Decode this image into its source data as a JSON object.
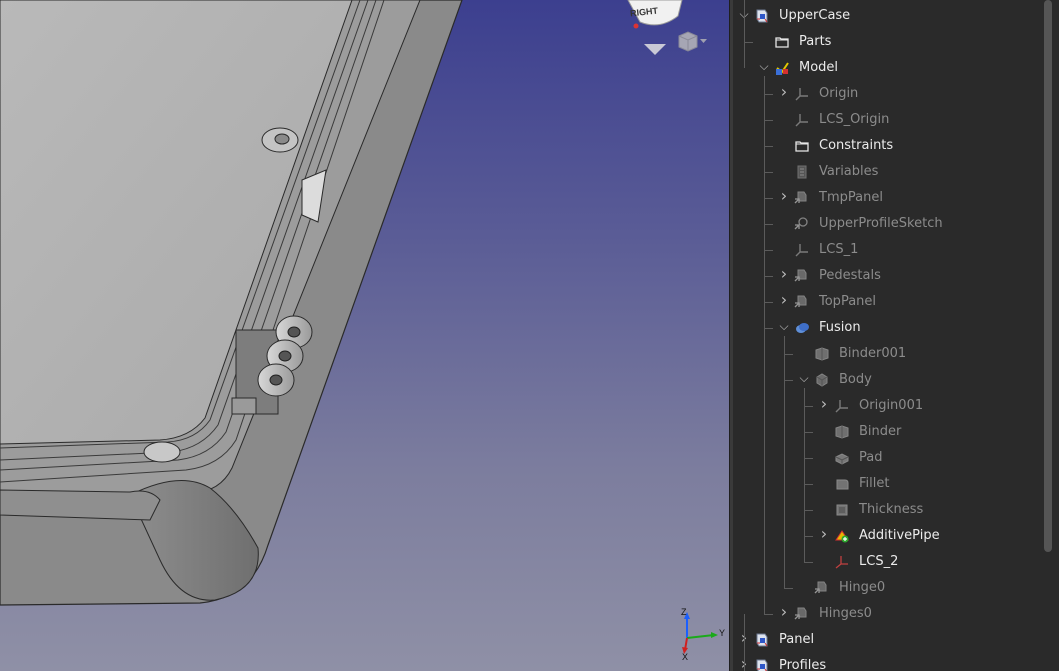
{
  "navigation_cube": {
    "face_label": "RIGHT",
    "menu_icon": "cube-menu-icon",
    "arrow_icon": "triangle-down-icon"
  },
  "axis_triad": {
    "z": "Z",
    "y": "Y",
    "x": "X"
  },
  "tree": {
    "items": [
      {
        "id": "uppercase",
        "label": "UpperCase",
        "depth": 0,
        "expander": "open",
        "enabled": true,
        "icon": "part-icon"
      },
      {
        "id": "parts",
        "label": "Parts",
        "depth": 1,
        "expander": "none",
        "enabled": true,
        "icon": "folder-icon"
      },
      {
        "id": "model",
        "label": "Model",
        "depth": 1,
        "expander": "open",
        "enabled": true,
        "icon": "model-icon"
      },
      {
        "id": "origin",
        "label": "Origin",
        "depth": 2,
        "expander": "closed",
        "enabled": false,
        "icon": "axes-icon"
      },
      {
        "id": "lcs-origin",
        "label": "LCS_Origin",
        "depth": 2,
        "expander": "none",
        "enabled": false,
        "icon": "axes-icon"
      },
      {
        "id": "constraints",
        "label": "Constraints",
        "depth": 2,
        "expander": "none",
        "enabled": true,
        "icon": "folder-icon"
      },
      {
        "id": "variables",
        "label": "Variables",
        "depth": 2,
        "expander": "none",
        "enabled": false,
        "icon": "variables-icon"
      },
      {
        "id": "tmppanel",
        "label": "TmpPanel",
        "depth": 2,
        "expander": "closed",
        "enabled": false,
        "icon": "link-icon"
      },
      {
        "id": "upperprofilesketch",
        "label": "UpperProfileSketch",
        "depth": 2,
        "expander": "none",
        "enabled": false,
        "icon": "sketch-link-icon"
      },
      {
        "id": "lcs-1",
        "label": "LCS_1",
        "depth": 2,
        "expander": "none",
        "enabled": false,
        "icon": "axes-icon"
      },
      {
        "id": "pedestals",
        "label": "Pedestals",
        "depth": 2,
        "expander": "closed",
        "enabled": false,
        "icon": "link-icon"
      },
      {
        "id": "toppanel",
        "label": "TopPanel",
        "depth": 2,
        "expander": "closed",
        "enabled": false,
        "icon": "link-icon"
      },
      {
        "id": "fusion",
        "label": "Fusion",
        "depth": 2,
        "expander": "open",
        "enabled": true,
        "icon": "fusion-icon"
      },
      {
        "id": "binder001",
        "label": "Binder001",
        "depth": 3,
        "expander": "none",
        "enabled": false,
        "icon": "binder-icon"
      },
      {
        "id": "body",
        "label": "Body",
        "depth": 3,
        "expander": "open",
        "enabled": false,
        "icon": "body-icon"
      },
      {
        "id": "origin001",
        "label": "Origin001",
        "depth": 4,
        "expander": "closed",
        "enabled": false,
        "icon": "axes-icon"
      },
      {
        "id": "binder",
        "label": "Binder",
        "depth": 4,
        "expander": "none",
        "enabled": false,
        "icon": "binder-icon"
      },
      {
        "id": "pad",
        "label": "Pad",
        "depth": 4,
        "expander": "none",
        "enabled": false,
        "icon": "pad-icon"
      },
      {
        "id": "fillet",
        "label": "Fillet",
        "depth": 4,
        "expander": "none",
        "enabled": false,
        "icon": "fillet-icon"
      },
      {
        "id": "thickness",
        "label": "Thickness",
        "depth": 4,
        "expander": "none",
        "enabled": false,
        "icon": "thickness-icon"
      },
      {
        "id": "additivepipe",
        "label": "AdditivePipe",
        "depth": 4,
        "expander": "closed",
        "enabled": true,
        "icon": "additive-pipe-icon"
      },
      {
        "id": "lcs-2",
        "label": "LCS_2",
        "depth": 4,
        "expander": "none",
        "enabled": true,
        "icon": "lcs-red-icon"
      },
      {
        "id": "hinge0",
        "label": "Hinge0",
        "depth": 3,
        "expander": "none",
        "enabled": false,
        "icon": "link-icon"
      },
      {
        "id": "hinges0",
        "label": "Hinges0",
        "depth": 2,
        "expander": "closed",
        "enabled": false,
        "icon": "link-icon"
      },
      {
        "id": "panel",
        "label": "Panel",
        "depth": 0,
        "expander": "closed",
        "enabled": true,
        "icon": "part-icon"
      },
      {
        "id": "profiles",
        "label": "Profiles",
        "depth": 0,
        "expander": "closed",
        "enabled": true,
        "icon": "part-icon"
      }
    ]
  },
  "colors": {
    "viewport_top": "#3c3f8f",
    "viewport_bottom": "#8f90a6",
    "tree_bg": "#2a2a2a",
    "text_on": "#ececec",
    "text_off": "#8c8c8c"
  }
}
